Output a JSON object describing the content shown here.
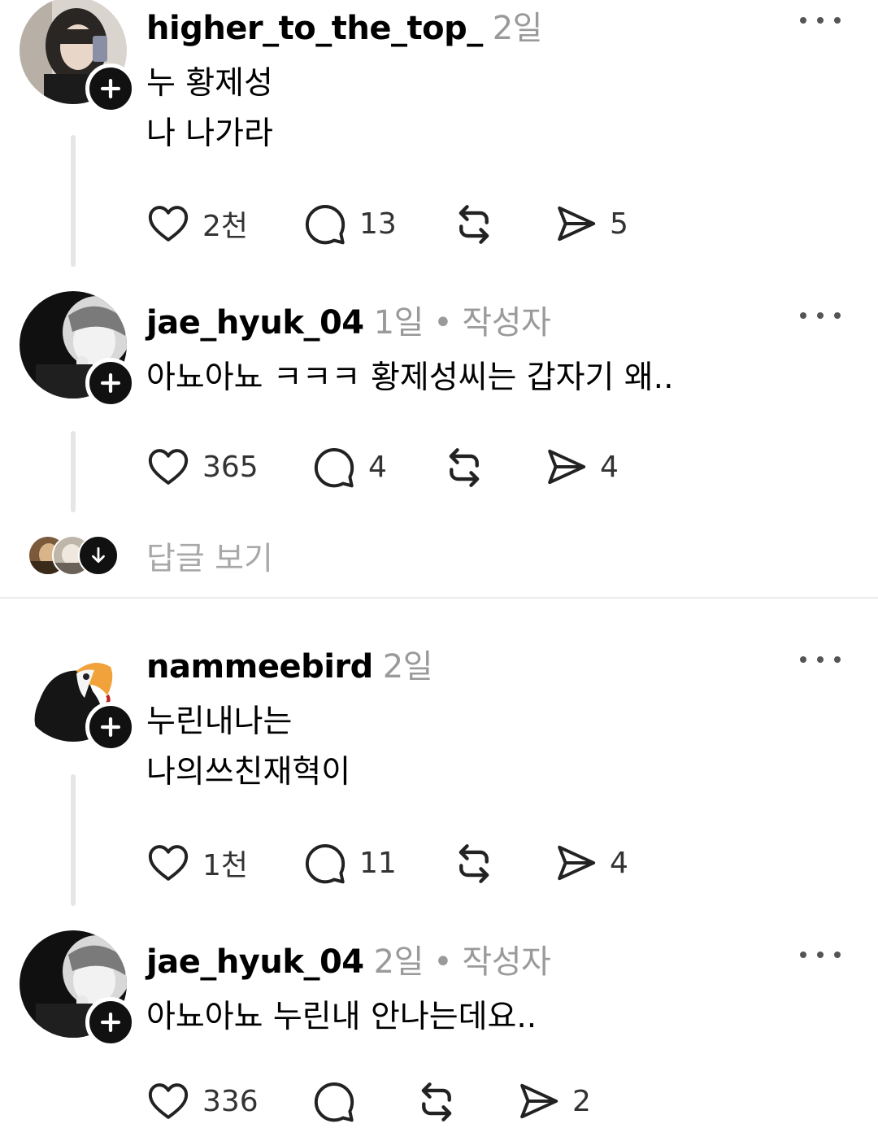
{
  "posts": [
    {
      "username": "higher_to_the_top_",
      "meta": "2일",
      "lines": [
        "누 황제성",
        "나 나가라"
      ],
      "likes": "2천",
      "comments": "13",
      "shares": "5"
    },
    {
      "username": "jae_hyuk_04",
      "meta": "1일 • 작성자",
      "lines": [
        "아뇨아뇨 ㅋㅋㅋ 황제성씨는 갑자기 왜.."
      ],
      "likes": "365",
      "comments": "4",
      "shares": "4"
    },
    {
      "username": "nammeebird",
      "meta": "2일",
      "lines": [
        "누린내나는",
        "나의쓰친재혁이"
      ],
      "likes": "1천",
      "comments": "11",
      "shares": "4"
    },
    {
      "username": "jae_hyuk_04",
      "meta": "2일 • 작성자",
      "lines": [
        "아뇨아뇨 누린내 안나는데요.."
      ],
      "likes": "336",
      "comments": "",
      "shares": "2"
    }
  ],
  "view_replies_label": "답글 보기",
  "icons": {
    "like": "heart-icon",
    "comment": "comment-icon",
    "repost": "repost-icon",
    "share": "send-icon",
    "more": "more-icon",
    "follow": "plus-icon",
    "expand": "arrow-down-icon"
  },
  "colors": {
    "text": "#000000",
    "muted": "#9a9a9a",
    "thread_line": "#e6e6e6",
    "follow_button": "#111111"
  }
}
